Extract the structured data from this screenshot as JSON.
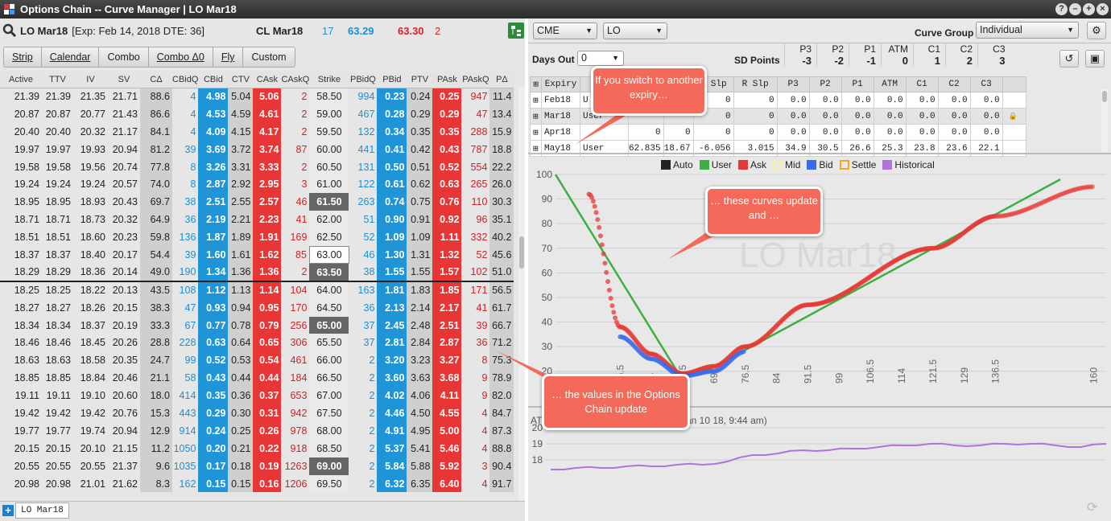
{
  "window": {
    "title": "Options Chain -- Curve Manager | LO Mar18"
  },
  "instrument": {
    "name": "LO Mar18",
    "info": "[Exp: Feb 14, 2018 DTE: 36]",
    "underlying": "CL Mar18",
    "bid_qty": "17",
    "bid": "63.29",
    "ask": "63.30",
    "ask_qty": "2"
  },
  "tabs": [
    "Strip",
    "Calendar",
    "Combo",
    "Combo Δ0",
    "Fly",
    "Custom"
  ],
  "columns": [
    "Active",
    "TTV",
    "IV",
    "SV",
    "CΔ",
    "CBidQ",
    "CBid",
    "CTV",
    "CAsk",
    "CAskQ",
    "Strike",
    "PBidQ",
    "PBid",
    "PTV",
    "PAsk",
    "PAskQ",
    "PΔ"
  ],
  "rows": [
    [
      "21.39",
      "21.39",
      "21.35",
      "21.71",
      "88.6",
      "4",
      "4.98",
      "5.04",
      "5.06",
      "2",
      "58.50",
      "994",
      "0.23",
      "0.24",
      "0.25",
      "947",
      "11.4"
    ],
    [
      "20.87",
      "20.87",
      "20.77",
      "21.43",
      "86.6",
      "4",
      "4.53",
      "4.59",
      "4.61",
      "2",
      "59.00",
      "467",
      "0.28",
      "0.29",
      "0.29",
      "47",
      "13.4"
    ],
    [
      "20.40",
      "20.40",
      "20.32",
      "21.17",
      "84.1",
      "4",
      "4.09",
      "4.15",
      "4.17",
      "2",
      "59.50",
      "132",
      "0.34",
      "0.35",
      "0.35",
      "288",
      "15.9"
    ],
    [
      "19.97",
      "19.97",
      "19.93",
      "20.94",
      "81.2",
      "39",
      "3.69",
      "3.72",
      "3.74",
      "87",
      "60.00",
      "441",
      "0.41",
      "0.42",
      "0.43",
      "787",
      "18.8"
    ],
    [
      "19.58",
      "19.58",
      "19.56",
      "20.74",
      "77.8",
      "8",
      "3.26",
      "3.31",
      "3.33",
      "2",
      "60.50",
      "131",
      "0.50",
      "0.51",
      "0.52",
      "554",
      "22.2"
    ],
    [
      "19.24",
      "19.24",
      "19.24",
      "20.57",
      "74.0",
      "8",
      "2.87",
      "2.92",
      "2.95",
      "3",
      "61.00",
      "122",
      "0.61",
      "0.62",
      "0.63",
      "265",
      "26.0"
    ],
    [
      "18.95",
      "18.95",
      "18.93",
      "20.43",
      "69.7",
      "38",
      "2.51",
      "2.55",
      "2.57",
      "46",
      "61.50",
      "263",
      "0.74",
      "0.75",
      "0.76",
      "110",
      "30.3"
    ],
    [
      "18.71",
      "18.71",
      "18.73",
      "20.32",
      "64.9",
      "36",
      "2.19",
      "2.21",
      "2.23",
      "41",
      "62.00",
      "51",
      "0.90",
      "0.91",
      "0.92",
      "96",
      "35.1"
    ],
    [
      "18.51",
      "18.51",
      "18.60",
      "20.23",
      "59.8",
      "136",
      "1.87",
      "1.89",
      "1.91",
      "169",
      "62.50",
      "52",
      "1.09",
      "1.09",
      "1.11",
      "332",
      "40.2"
    ],
    [
      "18.37",
      "18.37",
      "18.40",
      "20.17",
      "54.4",
      "39",
      "1.60",
      "1.61",
      "1.62",
      "85",
      "63.00",
      "46",
      "1.30",
      "1.31",
      "1.32",
      "52",
      "45.6"
    ],
    [
      "18.29",
      "18.29",
      "18.36",
      "20.14",
      "49.0",
      "190",
      "1.34",
      "1.36",
      "1.36",
      "2",
      "63.50",
      "38",
      "1.55",
      "1.55",
      "1.57",
      "102",
      "51.0"
    ],
    [
      "18.25",
      "18.25",
      "18.22",
      "20.13",
      "43.5",
      "108",
      "1.12",
      "1.13",
      "1.14",
      "104",
      "64.00",
      "163",
      "1.81",
      "1.83",
      "1.85",
      "171",
      "56.5"
    ],
    [
      "18.27",
      "18.27",
      "18.26",
      "20.15",
      "38.3",
      "47",
      "0.93",
      "0.94",
      "0.95",
      "170",
      "64.50",
      "36",
      "2.13",
      "2.14",
      "2.17",
      "41",
      "61.7"
    ],
    [
      "18.34",
      "18.34",
      "18.37",
      "20.19",
      "33.3",
      "67",
      "0.77",
      "0.78",
      "0.79",
      "256",
      "65.00",
      "37",
      "2.45",
      "2.48",
      "2.51",
      "39",
      "66.7"
    ],
    [
      "18.46",
      "18.46",
      "18.45",
      "20.26",
      "28.8",
      "228",
      "0.63",
      "0.64",
      "0.65",
      "306",
      "65.50",
      "37",
      "2.81",
      "2.84",
      "2.87",
      "36",
      "71.2"
    ],
    [
      "18.63",
      "18.63",
      "18.58",
      "20.35",
      "24.7",
      "99",
      "0.52",
      "0.53",
      "0.54",
      "461",
      "66.00",
      "2",
      "3.20",
      "3.23",
      "3.27",
      "8",
      "75.3"
    ],
    [
      "18.85",
      "18.85",
      "18.84",
      "20.46",
      "21.1",
      "58",
      "0.43",
      "0.44",
      "0.44",
      "184",
      "66.50",
      "2",
      "3.60",
      "3.63",
      "3.68",
      "9",
      "78.9"
    ],
    [
      "19.11",
      "19.11",
      "19.10",
      "20.60",
      "18.0",
      "414",
      "0.35",
      "0.36",
      "0.37",
      "653",
      "67.00",
      "2",
      "4.02",
      "4.06",
      "4.11",
      "9",
      "82.0"
    ],
    [
      "19.42",
      "19.42",
      "19.42",
      "20.76",
      "15.3",
      "443",
      "0.29",
      "0.30",
      "0.31",
      "942",
      "67.50",
      "2",
      "4.46",
      "4.50",
      "4.55",
      "4",
      "84.7"
    ],
    [
      "19.77",
      "19.77",
      "19.74",
      "20.94",
      "12.9",
      "914",
      "0.24",
      "0.25",
      "0.26",
      "978",
      "68.00",
      "2",
      "4.91",
      "4.95",
      "5.00",
      "4",
      "87.3"
    ],
    [
      "20.15",
      "20.15",
      "20.10",
      "21.15",
      "11.2",
      "1050",
      "0.20",
      "0.21",
      "0.22",
      "918",
      "68.50",
      "2",
      "5.37",
      "5.41",
      "5.46",
      "4",
      "88.8"
    ],
    [
      "20.55",
      "20.55",
      "20.55",
      "21.37",
      "9.6",
      "1035",
      "0.17",
      "0.18",
      "0.19",
      "1263",
      "69.00",
      "2",
      "5.84",
      "5.88",
      "5.92",
      "3",
      "90.4"
    ],
    [
      "20.98",
      "20.98",
      "21.01",
      "21.62",
      "8.3",
      "162",
      "0.15",
      "0.15",
      "0.16",
      "1206",
      "69.50",
      "2",
      "6.32",
      "6.35",
      "6.40",
      "4",
      "91.7"
    ]
  ],
  "bottom_tab": "LO Mar18",
  "right": {
    "exchange": "CME",
    "product": "LO",
    "curve_group_label": "Curve Group",
    "curve_group": "Individual",
    "days_out_label": "Days Out",
    "days_out": "0",
    "sd_points_label": "SD Points",
    "sd_headers": [
      "P3",
      "P2",
      "P1",
      "ATM",
      "C1",
      "C2",
      "C3"
    ],
    "sd_values": [
      "-3",
      "-2",
      "-1",
      "0",
      "1",
      "2",
      "3"
    ],
    "curve_headers": [
      "Expiry",
      "",
      "",
      "",
      "L Slp",
      "R Slp",
      "P3",
      "P2",
      "P1",
      "ATM",
      "C1",
      "C2",
      "C3"
    ],
    "curve_rows": [
      [
        "Feb18",
        "U",
        "",
        "",
        "0",
        "0",
        "0.0",
        "0.0",
        "0.0",
        "0.0",
        "0.0",
        "0.0",
        "0.0"
      ],
      [
        "Mar18",
        "User",
        "",
        "",
        "0",
        "0",
        "0.0",
        "0.0",
        "0.0",
        "0.0",
        "0.0",
        "0.0",
        "0.0"
      ],
      [
        "Apr18",
        "",
        "0",
        "0",
        "0",
        "0",
        "0.0",
        "0.0",
        "0.0",
        "0.0",
        "0.0",
        "0.0",
        "0.0"
      ],
      [
        "May18",
        "User",
        "62.835",
        "18.67",
        "-6.056",
        "3.015",
        "34.9",
        "30.5",
        "26.6",
        "25.3",
        "23.8",
        "23.6",
        "22.1"
      ]
    ],
    "legend": [
      {
        "name": "Auto",
        "color": "#222222"
      },
      {
        "name": "User",
        "color": "#3cb043"
      },
      {
        "name": "Ask",
        "color": "#e53935"
      },
      {
        "name": "Mid",
        "color": "#f4f0a0"
      },
      {
        "name": "Bid",
        "color": "#3a6bea"
      },
      {
        "name": "Settle",
        "color": "#f5a623"
      },
      {
        "name": "Historical",
        "color": "#b073d9"
      }
    ],
    "watermark": "LO Mar18",
    "atm_label": "ATM",
    "atm_note": "an 10 18, 9:44 am)"
  },
  "callouts": [
    "If you switch to another expiry…",
    "… these curves update and …",
    "… the values in the Options Chain update"
  ],
  "chart_data": [
    {
      "type": "line",
      "title": "",
      "x_ticks": [
        "46.5",
        "54",
        "61.5",
        "69",
        "76.5",
        "84",
        "91.5",
        "99",
        "106.5",
        "114",
        "121.5",
        "129",
        "136.5",
        "160"
      ],
      "y_ticks": [
        20,
        30,
        40,
        50,
        60,
        70,
        80,
        90,
        100
      ],
      "ylim": [
        15,
        100
      ],
      "series": [
        {
          "name": "User",
          "values": [
            [
              31,
              100
            ],
            [
              60.5,
              19
            ],
            [
              66,
              19
            ],
            [
              152,
              98
            ]
          ]
        },
        {
          "name": "Ask",
          "values": [
            [
              39,
              92
            ],
            [
              46.5,
              38
            ],
            [
              54,
              27
            ],
            [
              61.5,
              19
            ],
            [
              69,
              22
            ],
            [
              76.5,
              30
            ],
            [
              91.5,
              47
            ],
            [
              121.5,
              70
            ],
            [
              136.5,
              83
            ],
            [
              160,
              95
            ]
          ]
        },
        {
          "name": "Bid",
          "values": [
            [
              46.5,
              34
            ],
            [
              54,
              25
            ],
            [
              61.5,
              18
            ],
            [
              69,
              20
            ],
            [
              76.5,
              28
            ]
          ]
        }
      ]
    },
    {
      "type": "line",
      "title": "",
      "y_ticks": [
        18,
        19,
        20
      ],
      "ylim": [
        17,
        20
      ],
      "series": [
        {
          "name": "Historical",
          "values": [
            17.4,
            17.5,
            17.5,
            17.6,
            17.6,
            17.7,
            17.7,
            17.9,
            18.3,
            18.4,
            18.6,
            18.6,
            18.7,
            18.8,
            18.9,
            19.0,
            18.9,
            18.9,
            19.0,
            19.0,
            18.9,
            18.8,
            19.0
          ]
        }
      ]
    }
  ]
}
